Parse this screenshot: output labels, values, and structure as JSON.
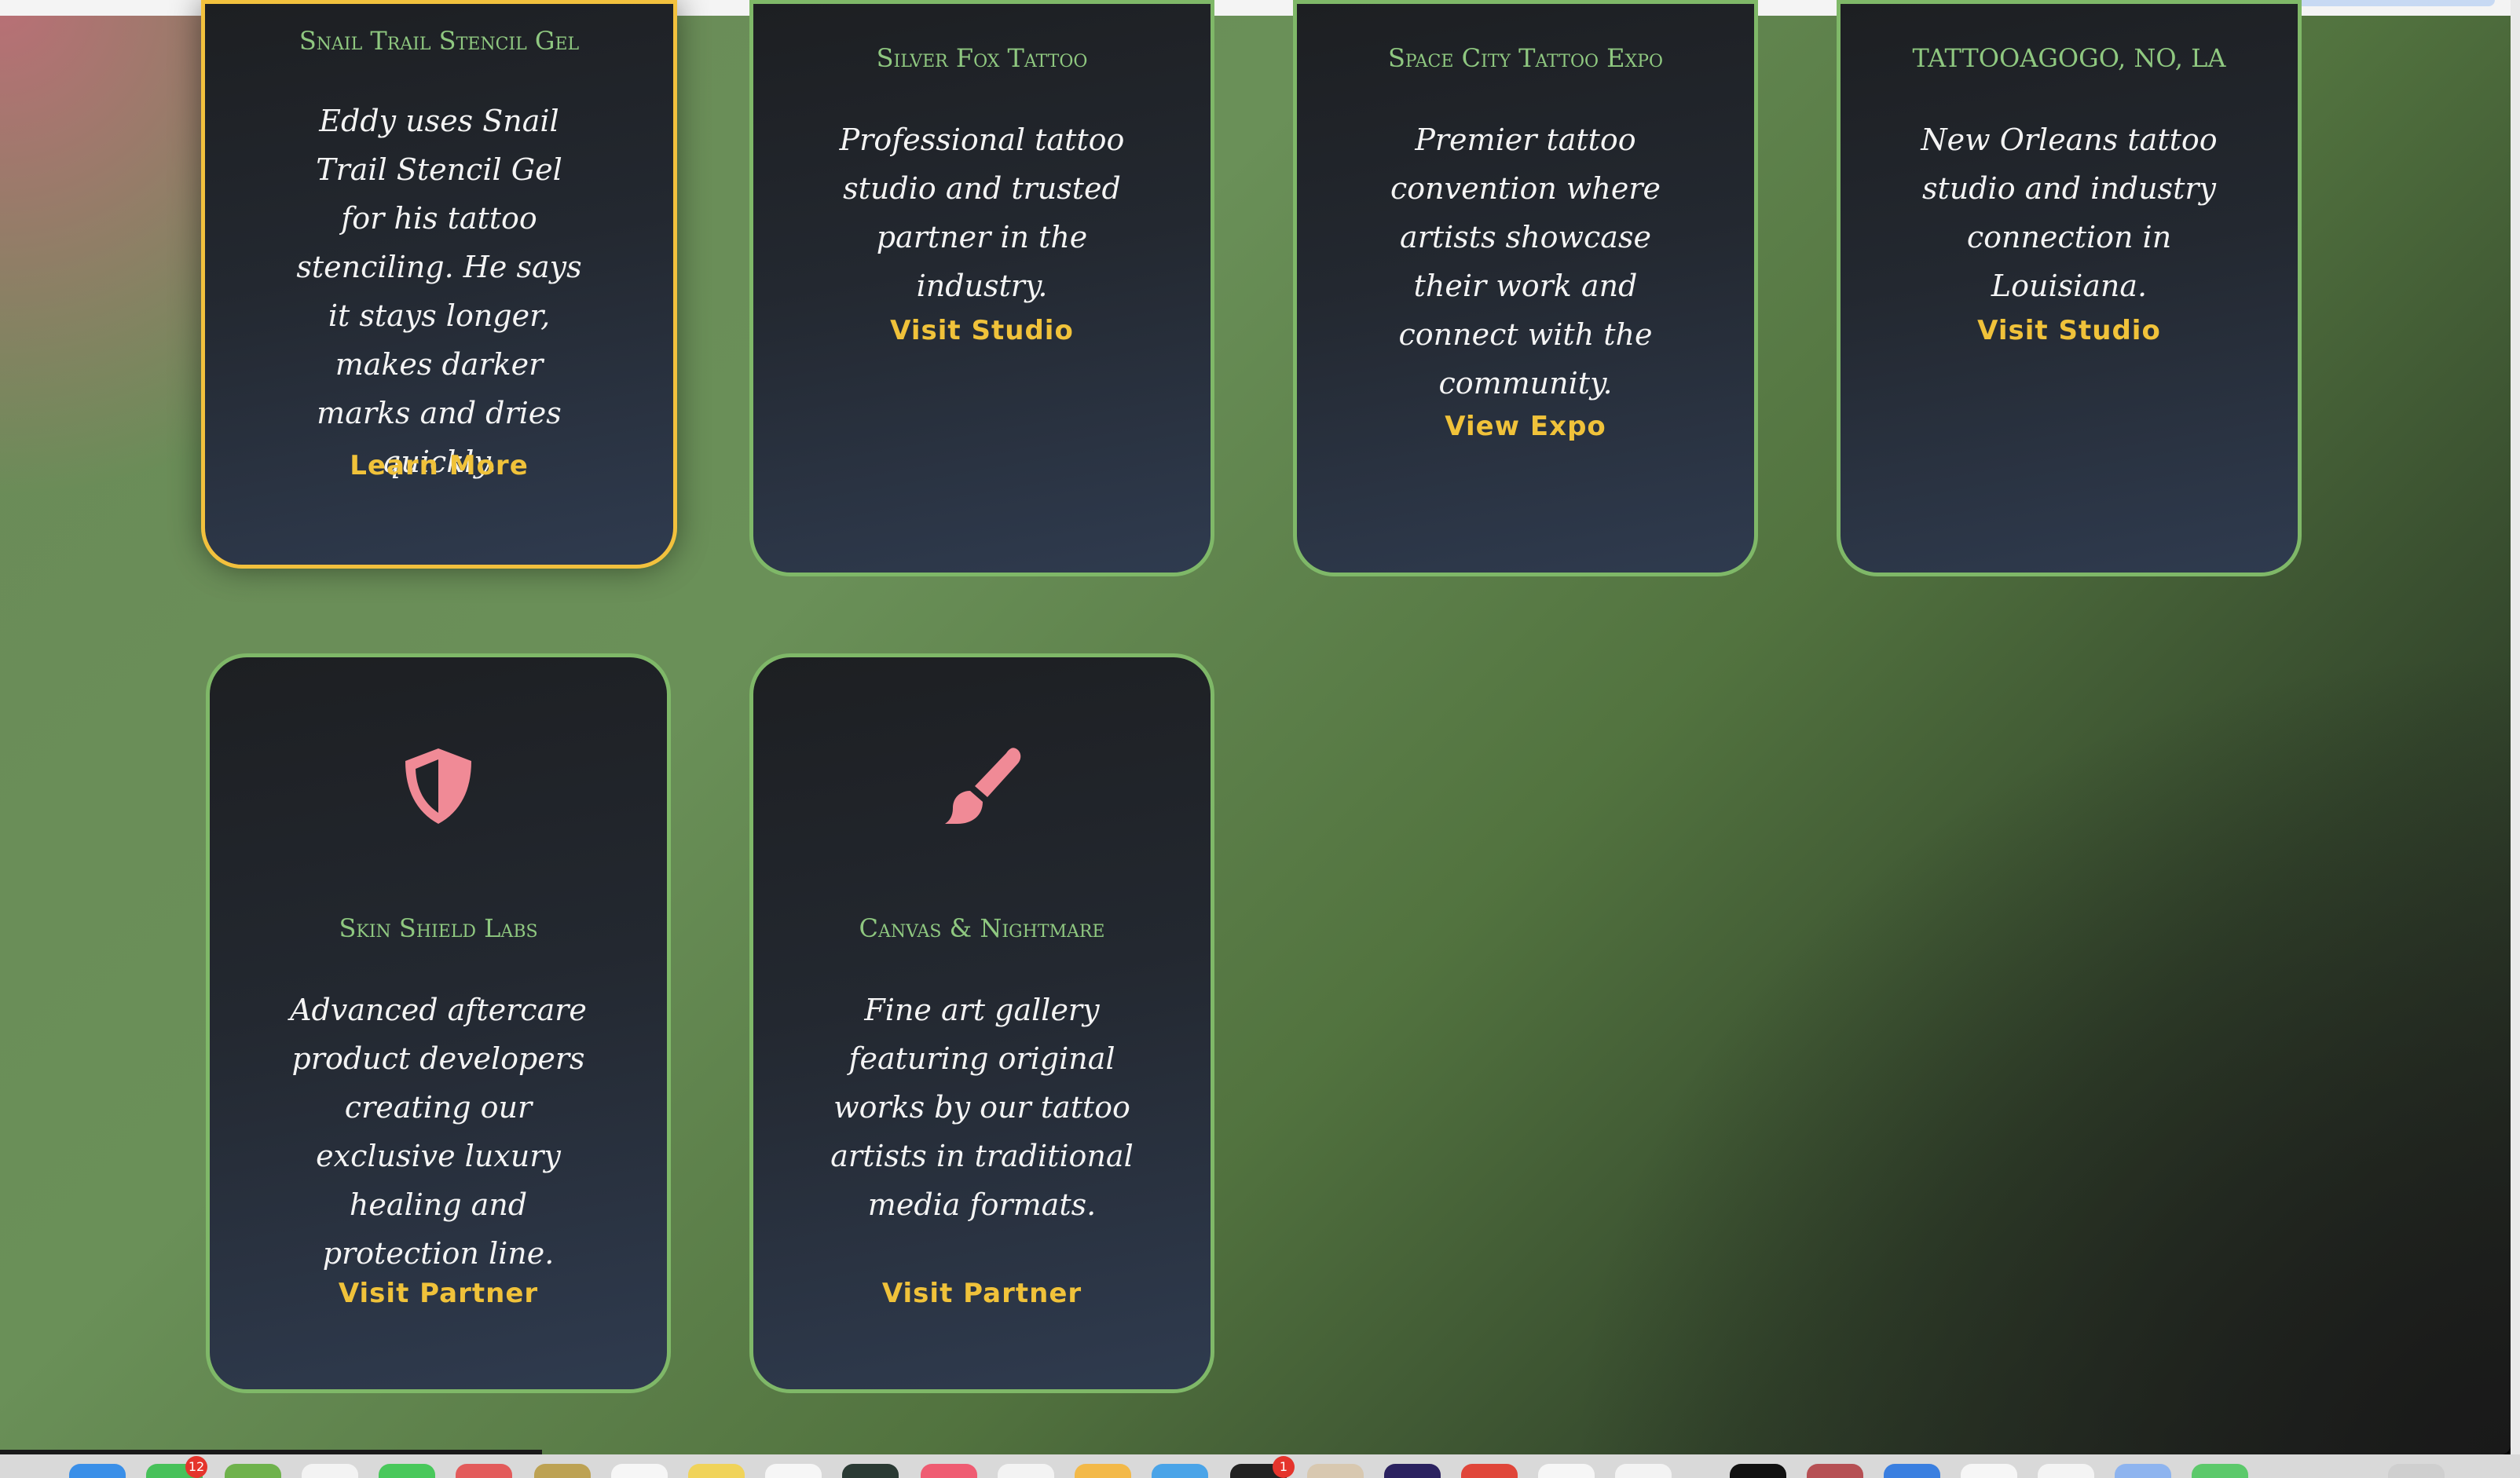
{
  "cards": [
    {
      "title": "Snail Trail Stencil Gel",
      "description": "Eddy uses Snail Trail Stencil Gel for his tattoo stenciling. He says it stays longer, makes darker marks and dries quickly.",
      "link": "Learn More"
    },
    {
      "title": "Silver Fox Tattoo",
      "description": "Professional tattoo studio and trusted partner in the industry.",
      "link": "Visit Studio"
    },
    {
      "title": "Space City Tattoo Expo",
      "description": "Premier tattoo convention where artists showcase their work and connect with the community.",
      "link": "View Expo"
    },
    {
      "title": "TATTOOAGOGO, NO, LA",
      "description": "New Orleans tattoo studio and industry connection in Louisiana.",
      "link": "Visit Studio"
    },
    {
      "title": "Skin Shield Labs",
      "description": "Advanced aftercare product developers creating our exclusive luxury healing and protection line.",
      "link": "Visit Partner",
      "icon": "shield-icon"
    },
    {
      "title": "Canvas & Nightmare",
      "description": "Fine art gallery featuring original works by our tattoo artists in traditional media formats.",
      "link": "Visit Partner",
      "icon": "paintbrush-icon"
    }
  ],
  "colors": {
    "card_border": "#7fb868",
    "featured_border": "#f2c13d",
    "title": "#8fc880",
    "link": "#f0c23a",
    "icon": "#f08a96"
  },
  "dock": {
    "badges": [
      "12",
      "1"
    ]
  }
}
